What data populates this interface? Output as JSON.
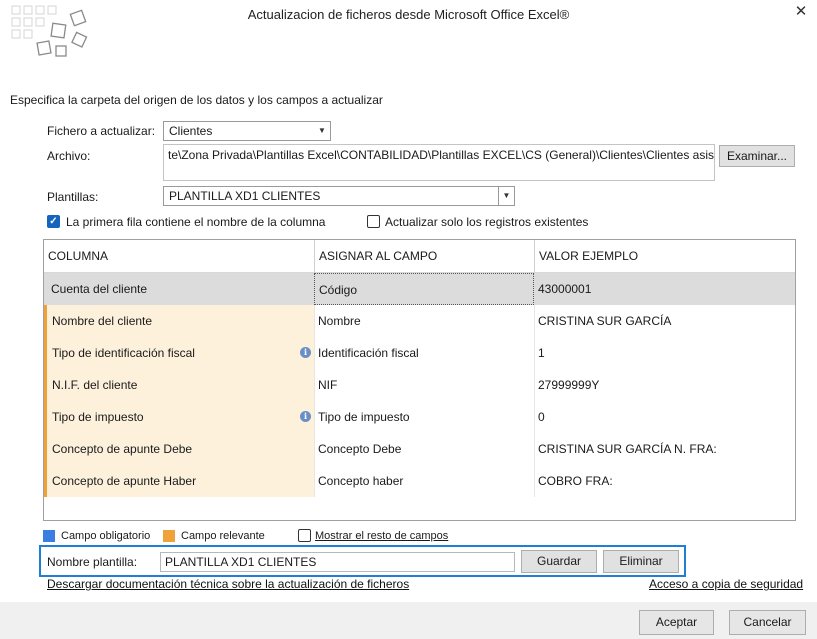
{
  "window": {
    "title": "Actualizacion de ficheros desde Microsoft Office Excel®",
    "close_glyph": "✕"
  },
  "instructions": "Especifica la carpeta del origen de los datos y los campos a actualizar",
  "form": {
    "fichero_label": "Fichero a actualizar:",
    "fichero_value": "Clientes",
    "archivo_label": "Archivo:",
    "archivo_value": "te\\Zona Privada\\Plantillas Excel\\CONTABILIDAD\\Plantillas EXCEL\\CS (General)\\Clientes\\Clientes asistente.xlsx",
    "examinar_label": "Examinar...",
    "plantillas_label": "Plantillas:",
    "plantillas_value": "PLANTILLA XD1 CLIENTES"
  },
  "options": {
    "primera_fila": {
      "label": "La primera fila contiene el nombre de la columna",
      "checked": true
    },
    "solo_existentes": {
      "label": "Actualizar solo los registros existentes",
      "checked": false
    }
  },
  "grid": {
    "headers": [
      "COLUMNA",
      "ASIGNAR AL CAMPO",
      "VALOR EJEMPLO"
    ],
    "rows": [
      {
        "columna": "Cuenta del cliente",
        "campo": "Código",
        "valor": "43000001",
        "kind": "selected",
        "info": false
      },
      {
        "columna": "Nombre del cliente",
        "campo": "Nombre",
        "valor": "CRISTINA SUR GARCÍA",
        "kind": "relevant",
        "info": false
      },
      {
        "columna": "Tipo de identificación fiscal",
        "campo": "Identificación fiscal",
        "valor": "1",
        "kind": "relevant",
        "info": true
      },
      {
        "columna": "N.I.F. del cliente",
        "campo": "NIF",
        "valor": "27999999Y",
        "kind": "relevant",
        "info": false
      },
      {
        "columna": "Tipo de impuesto",
        "campo": "Tipo de impuesto",
        "valor": "0",
        "kind": "relevant",
        "info": true
      },
      {
        "columna": "Concepto de apunte Debe",
        "campo": "Concepto Debe",
        "valor": "CRISTINA SUR GARCÍA N. FRA:",
        "kind": "relevant",
        "info": false
      },
      {
        "columna": "Concepto de apunte Haber",
        "campo": "Concepto haber",
        "valor": "COBRO FRA:",
        "kind": "relevant",
        "info": false
      }
    ]
  },
  "legend": {
    "obligatorio": "Campo obligatorio",
    "relevante": "Campo relevante",
    "mostrar": "Mostrar el resto de campos",
    "colors": {
      "obligatorio": "#3a7fe0",
      "relevante": "#f0a23a"
    }
  },
  "plantilla_box": {
    "label": "Nombre plantilla:",
    "value": "PLANTILLA XD1 CLIENTES",
    "guardar": "Guardar",
    "eliminar": "Eliminar"
  },
  "links": {
    "documentacion": "Descargar documentación técnica sobre la actualización de ficheros",
    "copia": "Acceso a copia de seguridad"
  },
  "footer": {
    "aceptar": "Aceptar",
    "cancelar": "Cancelar"
  }
}
